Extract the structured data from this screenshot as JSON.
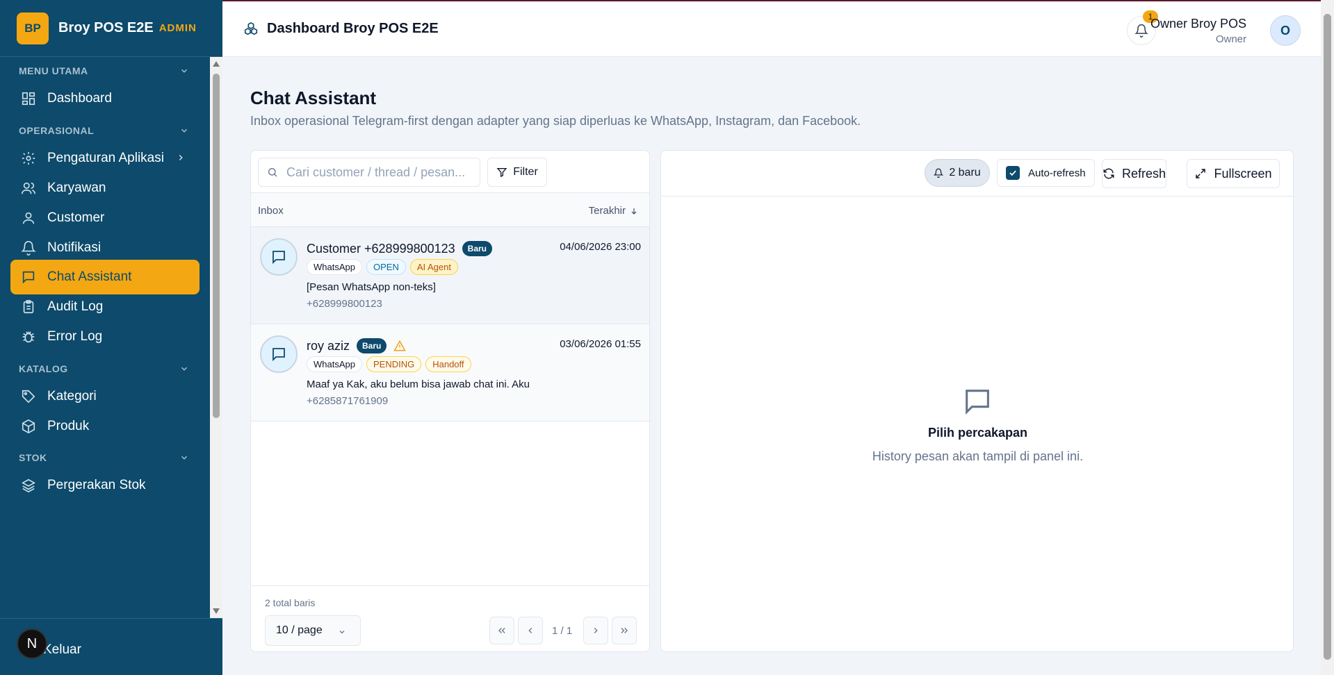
{
  "brand": {
    "logo": "BP",
    "name": "Broy POS E2E",
    "tag": "ADMIN"
  },
  "sidebar": {
    "sections": [
      {
        "label": "MENU UTAMA"
      },
      {
        "label": "OPERASIONAL"
      },
      {
        "label": "KATALOG"
      },
      {
        "label": "STOK"
      }
    ],
    "items": [
      {
        "label": "Dashboard",
        "icon": "grid-icon"
      },
      {
        "label": "Pengaturan Aplikasi",
        "icon": "gear-icon"
      },
      {
        "label": "Karyawan",
        "icon": "users-icon"
      },
      {
        "label": "Customer",
        "icon": "user-icon"
      },
      {
        "label": "Notifikasi",
        "icon": "bell-icon"
      },
      {
        "label": "Chat Assistant",
        "icon": "chat-icon",
        "active": true
      },
      {
        "label": "Audit Log",
        "icon": "clipboard-icon"
      },
      {
        "label": "Error Log",
        "icon": "bug-icon"
      },
      {
        "label": "Kategori",
        "icon": "tag-icon"
      },
      {
        "label": "Produk",
        "icon": "package-icon"
      },
      {
        "label": "Pergerakan Stok",
        "icon": "layers-icon"
      }
    ],
    "logout": "Keluar",
    "next_badge": "N"
  },
  "header": {
    "title": "Dashboard Broy POS E2E",
    "notif_count": "1",
    "user_name": "Owner Broy POS",
    "user_role": "Owner",
    "avatar": "O"
  },
  "page": {
    "title": "Chat Assistant",
    "subtitle": "Inbox operasional Telegram-first dengan adapter yang siap diperluas ke WhatsApp, Instagram, dan Facebook."
  },
  "inbox": {
    "search_placeholder": "Cari customer / thread / pesan...",
    "filter_label": "Filter",
    "col_left": "Inbox",
    "col_right": "Terakhir",
    "threads": [
      {
        "name": "Customer +628999800123",
        "badge": "Baru",
        "time": "04/06/2026 23:00",
        "channel": "WhatsApp",
        "status": "OPEN",
        "mode": "AI Agent",
        "message": "[Pesan WhatsApp non-teks]",
        "phone": "+628999800123"
      },
      {
        "name": "roy aziz",
        "badge": "Baru",
        "time": "03/06/2026 01:55",
        "channel": "WhatsApp",
        "status": "PENDING",
        "mode": "Handoff",
        "message": "Maaf ya Kak, aku belum bisa jawab chat ini. Aku",
        "phone": "+6285871761909"
      }
    ],
    "total": "2 total baris",
    "page_size": "10 / page",
    "page_info": "1 / 1"
  },
  "detail": {
    "new_pill": "2 baru",
    "auto_refresh": "Auto-refresh",
    "auto_refresh_checked": true,
    "refresh": "Refresh",
    "fullscreen": "Fullscreen",
    "empty_title": "Pilih percakapan",
    "empty_sub": "History pesan akan tampil di panel ini."
  }
}
